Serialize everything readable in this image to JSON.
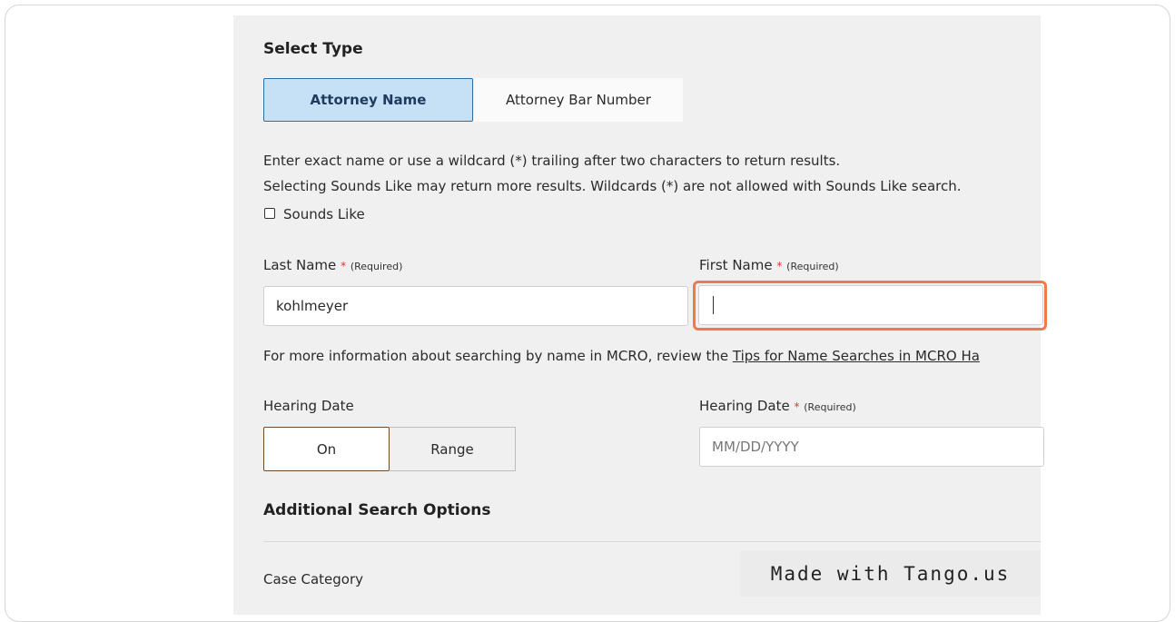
{
  "select_type": {
    "heading": "Select Type",
    "options": [
      "Attorney Name",
      "Attorney Bar Number"
    ],
    "selected": "Attorney Name"
  },
  "instructions": {
    "line1": "Enter exact name or use a wildcard (*) trailing after two characters to return results.",
    "line2": "Selecting Sounds Like may return more results. Wildcards (*) are not allowed with Sounds Like search.",
    "sounds_like_label": "Sounds Like"
  },
  "name_fields": {
    "last_name": {
      "label": "Last Name",
      "required_marker": "*",
      "required_note": "(Required)",
      "value": "kohlmeyer"
    },
    "first_name": {
      "label": "First Name",
      "required_marker": "*",
      "required_note": "(Required)",
      "value": ""
    }
  },
  "info": {
    "prefix": "For more information about searching by name in MCRO, review the ",
    "link_text": "Tips for Name Searches in MCRO Ha"
  },
  "hearing_date_mode": {
    "label": "Hearing Date",
    "options": [
      "On",
      "Range"
    ],
    "selected": "On"
  },
  "hearing_date_field": {
    "label": "Hearing Date",
    "required_marker": "*",
    "required_note": "(Required)",
    "placeholder": "MM/DD/YYYY"
  },
  "additional": {
    "heading": "Additional Search Options",
    "case_category_label": "Case Category"
  },
  "watermark": {
    "text": "Made with Tango.us"
  },
  "colors": {
    "panel_bg": "#f0f0f0",
    "active_type_bg": "#c6e1f5",
    "active_type_border": "#2f6ea3",
    "focus_ring": "#f07a4a",
    "required": "#dd3333"
  }
}
